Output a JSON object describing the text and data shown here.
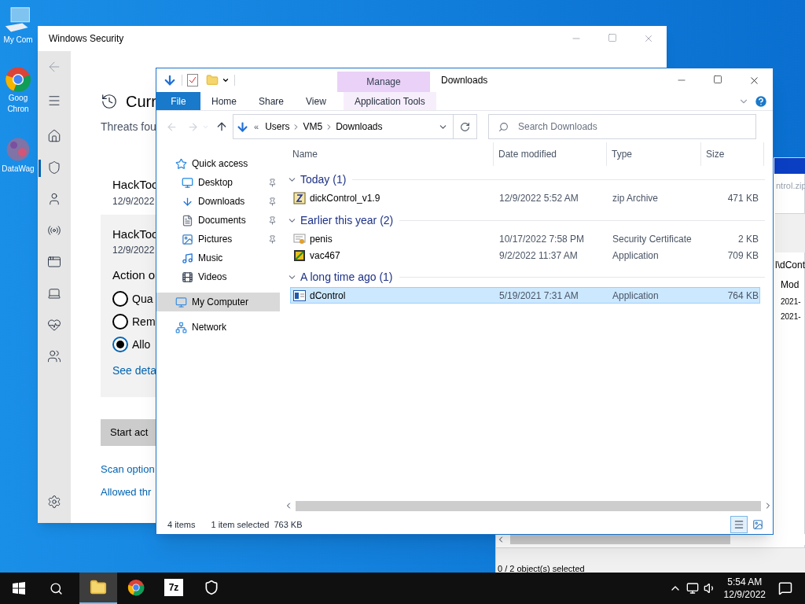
{
  "desktop_icons": [
    {
      "kind": "computer",
      "lines": [
        "My Com"
      ]
    },
    {
      "kind": "chrome",
      "lines": [
        "Goog",
        "Chron"
      ]
    },
    {
      "kind": "app",
      "lines": [
        "DataWag"
      ]
    }
  ],
  "security_window": {
    "title": "Windows Security",
    "nav_items": [
      {
        "kind": "home",
        "selected": false
      },
      {
        "kind": "shield",
        "selected": true
      },
      {
        "kind": "user",
        "selected": false
      },
      {
        "kind": "antenna",
        "selected": false
      },
      {
        "kind": "window",
        "selected": false
      },
      {
        "kind": "laptop",
        "selected": false
      },
      {
        "kind": "heart",
        "selected": false
      },
      {
        "kind": "family",
        "selected": false
      }
    ],
    "heading": "Curr",
    "subtitle": "Threats fou",
    "threat": {
      "name": "HackToo",
      "date": "12/9/2022"
    },
    "card": {
      "name": "HackToo",
      "date": "12/9/2022",
      "action_label": "Action o",
      "options": [
        {
          "label": "Qua",
          "selected": false
        },
        {
          "label": "Rem",
          "selected": false
        },
        {
          "label": "Allo",
          "selected": true
        }
      ],
      "link": "See deta"
    },
    "button": "Start act",
    "links": [
      "Scan option",
      "Allowed thr"
    ]
  },
  "back_window": {
    "title_text": "ntrol.zip",
    "path": "l\\dCont",
    "column": "Mod",
    "cells": [
      "2021-",
      "2021-"
    ],
    "status": "0 / 2 object(s) selected"
  },
  "explorer": {
    "title": "Downloads",
    "context_group": "Manage",
    "context_tab": "Application Tools",
    "tabs": [
      {
        "label": "File",
        "kind": "file"
      },
      {
        "label": "Home",
        "kind": "tab"
      },
      {
        "label": "Share",
        "kind": "tab"
      },
      {
        "label": "View",
        "kind": "tab"
      }
    ],
    "breadcrumb_prefix": "«",
    "breadcrumb": [
      "Users",
      "VM5",
      "Downloads"
    ],
    "search_placeholder": "Search Downloads",
    "nav_pane": [
      {
        "label": "Quick access",
        "kind": "star",
        "pinned": false,
        "selected": false
      },
      {
        "label": "Desktop",
        "kind": "desktop",
        "pinned": true,
        "selected": false
      },
      {
        "label": "Downloads",
        "kind": "download",
        "pinned": true,
        "selected": false
      },
      {
        "label": "Documents",
        "kind": "document",
        "pinned": true,
        "selected": false
      },
      {
        "label": "Pictures",
        "kind": "picture",
        "pinned": true,
        "selected": false
      },
      {
        "label": "Music",
        "kind": "music",
        "pinned": false,
        "selected": false
      },
      {
        "label": "Videos",
        "kind": "video",
        "pinned": false,
        "selected": false
      },
      {
        "label": "My Computer",
        "kind": "computer",
        "pinned": false,
        "selected": true
      },
      {
        "label": "Network",
        "kind": "network",
        "pinned": false,
        "selected": false
      }
    ],
    "columns": [
      "Name",
      "Date modified",
      "Type",
      "Size"
    ],
    "groups": [
      {
        "label": "Today (1)",
        "expanded": true,
        "rows": [
          {
            "name": "dickControl_v1.9",
            "date": "12/9/2022 5:52 AM",
            "type": "zip Archive",
            "size": "471 KB",
            "kind": "zip",
            "selected": false
          }
        ]
      },
      {
        "label": "Earlier this year (2)",
        "expanded": true,
        "rows": [
          {
            "name": "penis",
            "date": "10/17/2022 7:58 PM",
            "type": "Security Certificate",
            "size": "2 KB",
            "kind": "certificate",
            "selected": false
          },
          {
            "name": "vac467",
            "date": "9/2/2022 11:37 AM",
            "type": "Application",
            "size": "709 KB",
            "kind": "app",
            "selected": false
          }
        ]
      },
      {
        "label": "A long time ago (1)",
        "expanded": true,
        "rows": [
          {
            "name": "dControl",
            "date": "5/19/2021 7:31 AM",
            "type": "Application",
            "size": "764 KB",
            "kind": "window-app",
            "selected": true
          }
        ]
      }
    ],
    "status": {
      "count": "4 items",
      "selection": "1 item selected",
      "size": "763 KB"
    },
    "views": [
      {
        "kind": "details",
        "selected": true
      },
      {
        "kind": "tiles",
        "selected": false
      }
    ]
  },
  "taskbar": {
    "apps": [
      {
        "kind": "explorer",
        "active": true
      },
      {
        "kind": "chrome",
        "active": false
      },
      {
        "kind": "sevenzip",
        "label": "7z",
        "active": false
      },
      {
        "kind": "shield",
        "active": false
      }
    ],
    "time": "5:54 AM",
    "date": "12/9/2022"
  }
}
